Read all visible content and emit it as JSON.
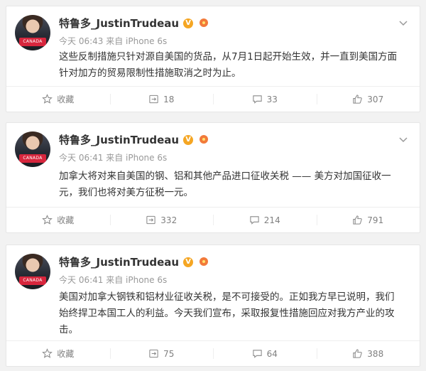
{
  "posts": [
    {
      "author": "特鲁多_JustinTrudeau",
      "vip_mark": "V",
      "meta": "今天 06:43 来自 iPhone 6s",
      "avatar_badge": "CANADA",
      "text": "这些反制措施只针对源自美国的货品，从7月1日起开始生效，并一直到美国方面\n针对加方的贸易限制性措施取消之时为止。",
      "favorite_label": "收藏",
      "repost_count": "18",
      "comment_count": "33",
      "like_count": "307"
    },
    {
      "author": "特鲁多_JustinTrudeau",
      "vip_mark": "V",
      "meta": "今天 06:41 来自 iPhone 6s",
      "avatar_badge": "CANADA",
      "text": "加拿大将对来自美国的钢、铝和其他产品进口征收关税 —— 美方对加国征收一\n元，我们也将对美方征税一元。",
      "favorite_label": "收藏",
      "repost_count": "332",
      "comment_count": "214",
      "like_count": "791"
    },
    {
      "author": "特鲁多_JustinTrudeau",
      "vip_mark": "V",
      "meta": "今天 06:41 来自 iPhone 6s",
      "avatar_badge": "CANADA",
      "text": "美国对加拿大钢铁和铝材业征收关税，是不可接受的。正如我方早已说明，我们\n始终捍卫本国工人的利益。今天我们宣布，采取报复性措施回应对我方产业的攻\n击。",
      "favorite_label": "收藏",
      "repost_count": "75",
      "comment_count": "64",
      "like_count": "388"
    }
  ],
  "icons": {
    "favorite": "star-icon",
    "repost": "repost-icon",
    "comment": "comment-icon",
    "like": "thumbs-up-icon",
    "menu": "chevron-down-icon",
    "vip": "verified-v-icon",
    "medal": "medal-icon"
  },
  "colors": {
    "background": "#f2f2f2",
    "card": "#ffffff",
    "vip": "#f5a623",
    "meta_text": "#999999"
  }
}
